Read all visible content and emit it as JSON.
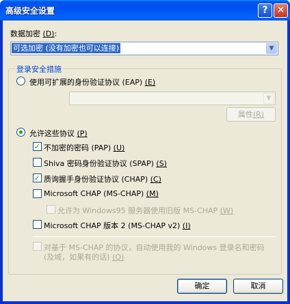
{
  "window": {
    "title": "高级安全设置",
    "help_glyph": "?",
    "close_glyph": "✕"
  },
  "encryption": {
    "label": "数据加密 ",
    "accel": "(D)",
    "colon": ":",
    "value": "可选加密 (没有加密也可以连接)"
  },
  "logon_group": {
    "title": "登录安全措施"
  },
  "eap": {
    "label": "使用可扩展的身份验证协议 (EAP) ",
    "accel": "(E)",
    "combo_value": "",
    "properties_label": "属性",
    "properties_accel": "(R)"
  },
  "allow": {
    "label": "允许这些协议 ",
    "accel": "(P)"
  },
  "protocols": [
    {
      "label": "不加密的密码 (PAP) ",
      "accel": "(U)",
      "checked": true
    },
    {
      "label": "Shiva 密码身份验证协议 (SPAP) ",
      "accel": "(S)",
      "checked": false
    },
    {
      "label": "质询握手身份验证协议 (CHAP) ",
      "accel": "(C)",
      "checked": true
    },
    {
      "label": "Microsoft CHAP (MS-CHAP) ",
      "accel": "(M)",
      "checked": false
    },
    {
      "label": "允许为 Windows95 服务器使用旧版 MS-CHAP ",
      "accel": "(W)",
      "checked": false
    },
    {
      "label": "Microsoft CHAP 版本 2 (MS-CHAP v2) ",
      "accel": "(I)",
      "checked": false
    }
  ],
  "auto_logon": {
    "line1": "对基于 MS-CHAP 的协议，自动使用我的 Windows 登录名和密码",
    "line2": "(及域，如果有的话) ",
    "accel": "(O)"
  },
  "buttons": {
    "ok": "确定",
    "cancel": "取消"
  },
  "glyphs": {
    "check": "✓",
    "dropdown": "▼"
  },
  "colors": {
    "title_bar": "#0058ee",
    "face": "#ece9d8",
    "selection": "#316ac5",
    "group_title": "#0046d5"
  }
}
